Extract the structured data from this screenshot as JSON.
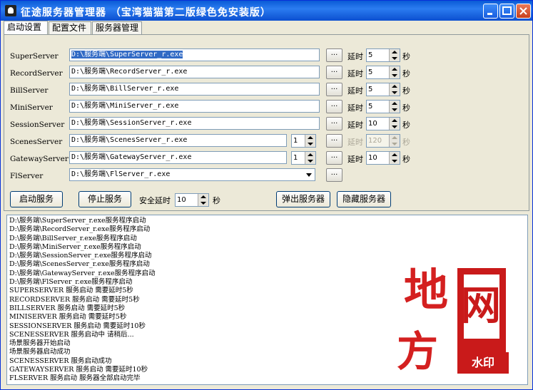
{
  "window": {
    "title": "征途服务器管理器  （宝湾猫猫第二版绿色免安装版）"
  },
  "tabs": [
    {
      "label": "启动设置"
    },
    {
      "label": "配置文件"
    },
    {
      "label": "服务器管理"
    }
  ],
  "servers": [
    {
      "name": "SuperServer",
      "path": "D:\\服务端\\SuperServer_r.exe",
      "delay": "5",
      "selected": true
    },
    {
      "name": "RecordServer",
      "path": "D:\\服务端\\RecordServer_r.exe",
      "delay": "5"
    },
    {
      "name": "BillServer",
      "path": "D:\\服务端\\BillServer_r.exe",
      "delay": "5"
    },
    {
      "name": "MiniServer",
      "path": "D:\\服务端\\MiniServer_r.exe",
      "delay": "5"
    },
    {
      "name": "SessionServer",
      "path": "D:\\服务端\\SessionServer_r.exe",
      "delay": "10"
    },
    {
      "name": "ScenesServer",
      "path": "D:\\服务端\\ScenesServer_r.exe",
      "count": "1",
      "delay": "120",
      "disabled": true
    },
    {
      "name": "GatewayServer",
      "path": "D:\\服务端\\GatewayServer_r.exe",
      "count": "1",
      "delay": "10"
    },
    {
      "name": "FlServer",
      "path": "D:\\服务端\\FlServer_r.exe"
    }
  ],
  "labels": {
    "browse": "...",
    "delay": "延时",
    "seconds": "秒",
    "safe_delay": "安全延时",
    "safe_delay_value": "10"
  },
  "buttons": {
    "start": "启动服务",
    "stop": "停止服务",
    "popup": "弹出服务器",
    "hide": "隐藏服务器"
  },
  "log": [
    "D:\\服务端\\SuperServer_r.exe服务程序启动",
    "D:\\服务端\\RecordServer_r.exe服务程序启动",
    "D:\\服务端\\BillServer_r.exe服务程序启动",
    "D:\\服务端\\MiniServer_r.exe服务程序启动",
    "D:\\服务端\\SessionServer_r.exe服务程序启动",
    "D:\\服务端\\ScenesServer_r.exe服务程序启动",
    "D:\\服务端\\GatewayServer_r.exe服务程序启动",
    "D:\\服务端\\FlServer_r.exe服务程序启动",
    "SUPERSERVER 服务启动 需要延时5秒",
    "RECORDSERVER 服务启动 需要延时5秒",
    "BILLSERVER 服务启动 需要延时5秒",
    "MINISERVER 服务启动 需要延时5秒",
    "SESSIONSERVER 服务启动 需要延时10秒",
    "SCENESSERVER 服务启动中 请稍后...",
    "场景服务器开始启动",
    "场景服务器启动成功",
    "SCENESSERVER 服务启动成功",
    "GATEWAYSERVER 服务启动 需要延时10秒",
    "FLSERVER 服务启动 服务器全部启动完毕"
  ],
  "watermark": {
    "char1": "地",
    "char2": "方",
    "char3": "网",
    "stamp": "水印"
  },
  "colors": {
    "accent": "#0a5bd6",
    "watermark": "#d42020"
  }
}
